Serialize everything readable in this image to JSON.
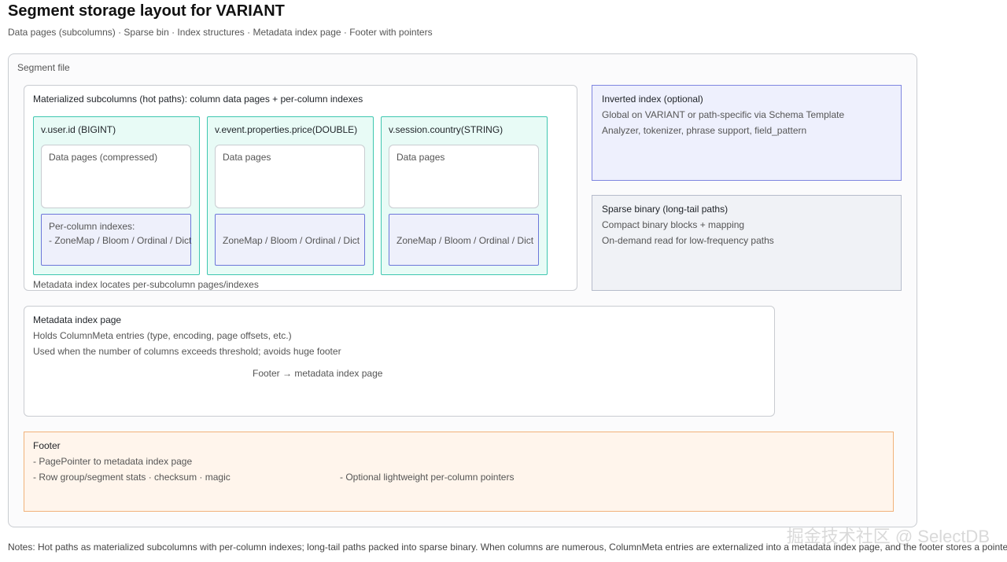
{
  "title": "Segment storage layout for VARIANT",
  "subtitle": "Data pages (subcolumns) · Sparse bin · Index structures · Metadata index page · Footer with pointers",
  "segment_file": {
    "label": "Segment file",
    "materialized": {
      "title": "Materialized subcolumns (hot paths): column data pages + per-column indexes",
      "columns": [
        {
          "name": "v.user.id (BIGINT)",
          "pages_label": "Data pages (compressed)",
          "index_lines": [
            "Per-column indexes:",
            "- ZoneMap / Bloom / Ordinal / Dict"
          ]
        },
        {
          "name": "v.event.properties.price(DOUBLE)",
          "pages_label": "Data pages",
          "index_lines": [
            "ZoneMap / Bloom / Ordinal / Dict"
          ]
        },
        {
          "name": "v.session.country(STRING)",
          "pages_label": "Data pages",
          "index_lines": [
            "ZoneMap / Bloom / Ordinal / Dict"
          ]
        }
      ],
      "caption": "Metadata index locates per-subcolumn pages/indexes"
    },
    "inverted_index": {
      "title": "Inverted index (optional)",
      "lines": [
        "Global on VARIANT or path-specific via Schema Template",
        "Analyzer, tokenizer, phrase support, field_pattern"
      ]
    },
    "sparse_binary": {
      "title": "Sparse binary (long-tail paths)",
      "lines": [
        "Compact binary blocks + mapping",
        "On-demand read for low-frequency paths"
      ]
    },
    "metadata_index_page": {
      "title": "Metadata index page",
      "lines": [
        "Holds ColumnMeta entries (type, encoding, page offsets, etc.)",
        "Used when the number of columns exceeds threshold; avoids huge footer"
      ],
      "pointer_note": "Footer → metadata index page"
    },
    "footer": {
      "title": "Footer",
      "line1": "- PagePointer to metadata index page",
      "line2": "- Row group/segment stats · checksum · magic",
      "line3": "- Optional lightweight per-column pointers"
    }
  },
  "notes": "Notes: Hot paths as materialized subcolumns with per-column indexes; long-tail paths packed into sparse binary. When columns are numerous, ColumnMeta entries are externalized into a metadata index page, and the footer stores a pointer.",
  "watermark": "掘金技术社区 @ SelectDB"
}
